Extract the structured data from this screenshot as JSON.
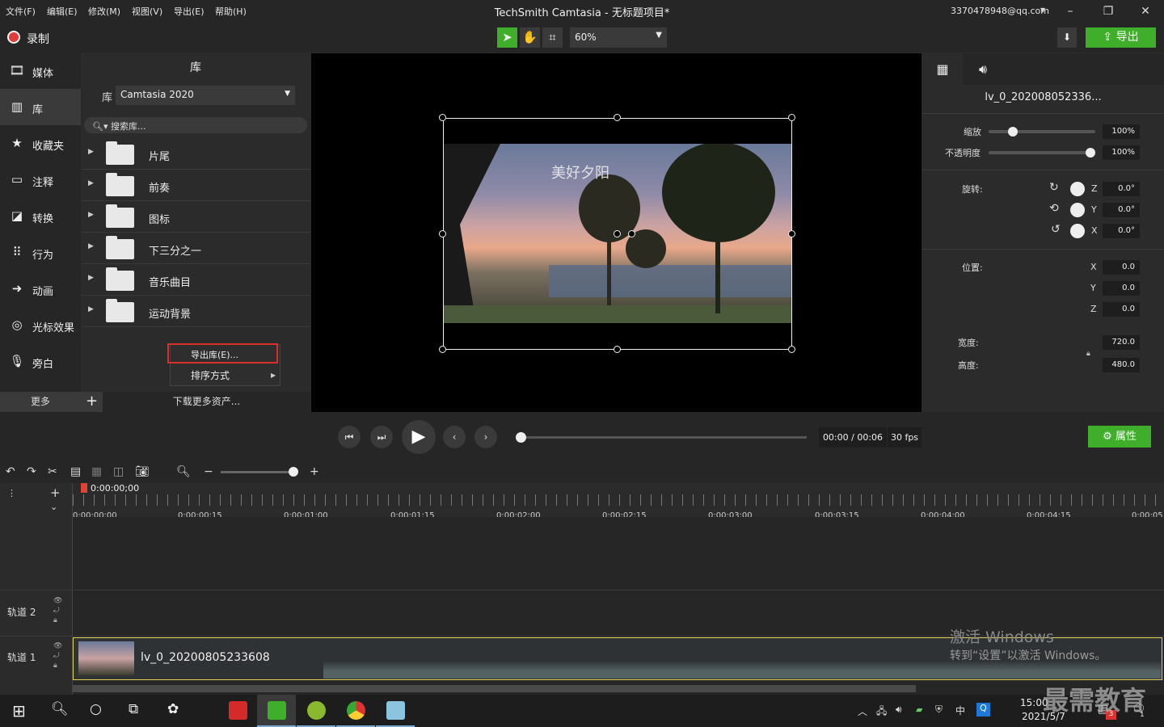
{
  "menu": [
    "文件(F)",
    "编辑(E)",
    "修改(M)",
    "视图(V)",
    "导出(E)",
    "帮助(H)"
  ],
  "window_title": "TechSmith Camtasia - 无标题项目*",
  "account": "3370478948@qq.com",
  "toolbar": {
    "record_label": "录制",
    "zoom": "60%",
    "export_label": "导出"
  },
  "nav": [
    "媒体",
    "库",
    "收藏夹",
    "注释",
    "转换",
    "行为",
    "动画",
    "光标效果",
    "旁白"
  ],
  "nav_selected": "库",
  "nav_more": "更多",
  "library": {
    "title": "库",
    "select_label": "库",
    "selected_library": "Camtasia 2020",
    "search_placeholder": "搜索库...",
    "folders": [
      "片尾",
      "前奏",
      "图标",
      "下三分之一",
      "音乐曲目",
      "运动背景"
    ],
    "context_menu": [
      "导出库(E)...",
      "排序方式"
    ],
    "download_more": "下载更多资产..."
  },
  "canvas": {
    "overlay_text": "美好夕阳"
  },
  "properties": {
    "clip_name": "lv_0_202008052336...",
    "scale_label": "缩放",
    "scale": "100%",
    "opacity_label": "不透明度",
    "opacity": "100%",
    "rotation_label": "旋转:",
    "rot_z": "0.0°",
    "rot_y": "0.0°",
    "rot_x": "0.0°",
    "position_label": "位置:",
    "pos_x": "0.0",
    "pos_y": "0.0",
    "pos_z": "0.0",
    "width_label": "宽度:",
    "width": "720.0",
    "height_label": "高度:",
    "height": "480.0",
    "axis": {
      "x": "X",
      "y": "Y",
      "z": "Z"
    },
    "button": "属性"
  },
  "player": {
    "time": "00:00 / 00:06",
    "fps": "30 fps",
    "progress": 0
  },
  "timeline": {
    "playhead_time": "0:00:00;00",
    "ticks": [
      "0:00:00;00",
      "0:00:00;15",
      "0:00:01;00",
      "0:00:01;15",
      "0:00:02;00",
      "0:00:02;15",
      "0:00:03;00",
      "0:00:03;15",
      "0:00:04;00",
      "0:00:04;15",
      "0:00:05"
    ],
    "tracks": [
      "轨道 2",
      "轨道 1"
    ],
    "clip_name": "lv_0_20200805233608"
  },
  "activation": {
    "line1": "激活 Windows",
    "line2": "转到“设置”以激活 Windows。"
  },
  "taskbar": {
    "time": "15:00",
    "date": "2021/5/7",
    "badge": "3",
    "notif": "1"
  },
  "watermark": "最需教育",
  "colors": {
    "accent_green": "#3fae2a",
    "record_red": "#e23b3b",
    "highlight_red": "#d9302c",
    "clip_border": "#e8d25a"
  }
}
